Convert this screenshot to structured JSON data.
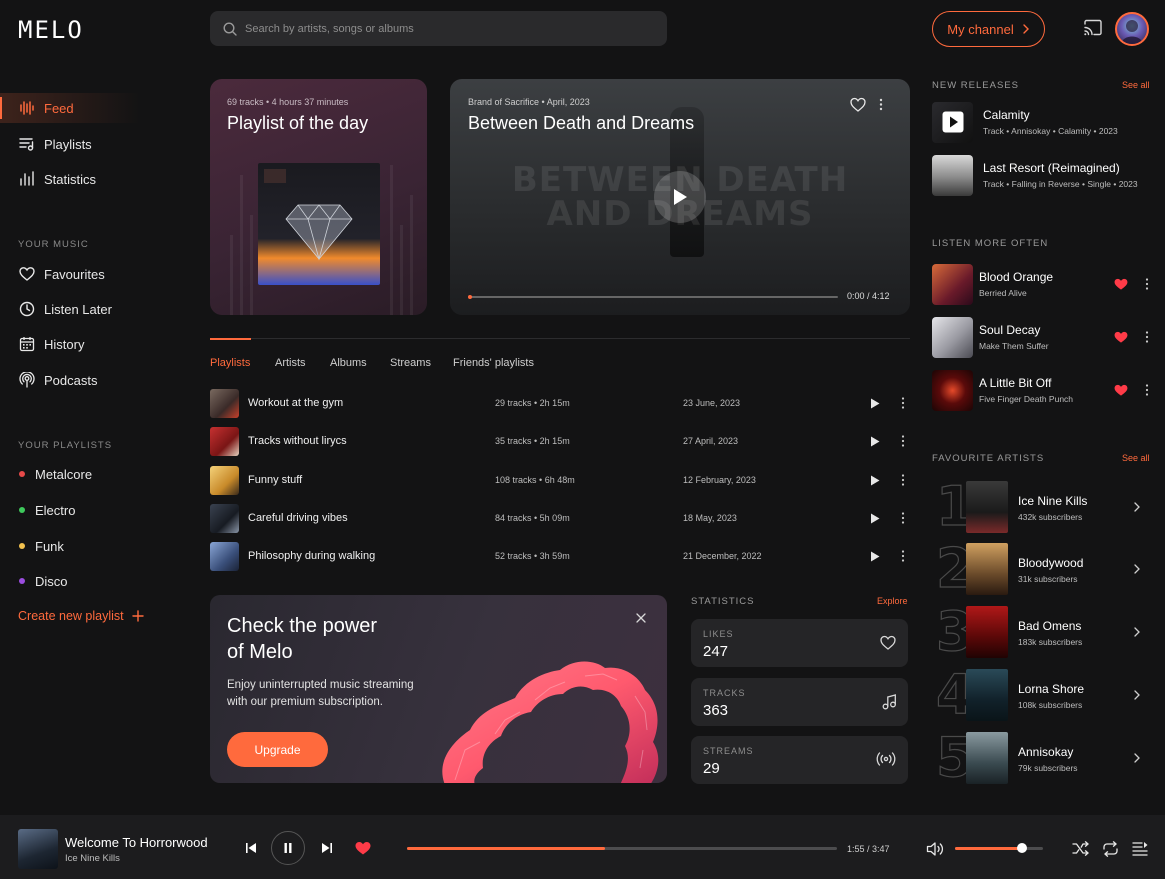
{
  "app": {
    "logo": "MELO"
  },
  "search": {
    "placeholder": "Search by artists, songs or albums"
  },
  "header": {
    "my_channel": "My channel"
  },
  "nav": [
    {
      "label": "Feed",
      "icon": "bars-icon"
    },
    {
      "label": "Playlists",
      "icon": "playlist-icon"
    },
    {
      "label": "Statistics",
      "icon": "statistics-icon"
    }
  ],
  "your_music": {
    "title": "YOUR MUSIC",
    "items": [
      {
        "label": "Favourites",
        "icon": "heart-icon"
      },
      {
        "label": "Listen Later",
        "icon": "clock-icon"
      },
      {
        "label": "History",
        "icon": "calendar-icon"
      },
      {
        "label": "Podcasts",
        "icon": "podcast-icon"
      }
    ]
  },
  "your_playlists": {
    "title": "YOUR PLAYLISTS",
    "items": [
      {
        "label": "Metalcore",
        "color": "#e84a4a"
      },
      {
        "label": "Electro",
        "color": "#3ec95c"
      },
      {
        "label": "Funk",
        "color": "#f2c14e"
      },
      {
        "label": "Disco",
        "color": "#9b4de0"
      }
    ],
    "create": "Create new playlist"
  },
  "playlist_of_day": {
    "tracks": "69 tracks",
    "duration": "4 hours 37 minutes",
    "title": "Playlist of the day"
  },
  "featured_video": {
    "artist": "Brand of Sacrifice",
    "date": "April, 2023",
    "title": "Between Death and Dreams",
    "overlay_text": "BETWEEN DEATH AND DREAMS",
    "time": "0:00 / 4:12"
  },
  "tabs": [
    "Playlists",
    "Artists",
    "Albums",
    "Streams",
    "Friends' playlists"
  ],
  "playlists": [
    {
      "name": "Workout at the gym",
      "tracks": "29 tracks",
      "duration": "2h 15m",
      "date": "23 June, 2023",
      "thumb": "linear-gradient(135deg,#7a6a60,#3a2a28 60%,#c9402a)"
    },
    {
      "name": "Tracks without lirycs",
      "tracks": "35 tracks",
      "duration": "2h 15m",
      "date": "27 April, 2023",
      "thumb": "linear-gradient(135deg,#c73131,#7a1515 60%,#e6d3c0)"
    },
    {
      "name": "Funny stuff",
      "tracks": "108 tracks",
      "duration": "6h 48m",
      "date": "12 February, 2023",
      "thumb": "linear-gradient(135deg,#f4d27a,#c88a2a 60%,#3a2a1a)"
    },
    {
      "name": "Careful driving vibes",
      "tracks": "84 tracks",
      "duration": "5h 09m",
      "date": "18 May, 2023",
      "thumb": "linear-gradient(135deg,#3a4250,#171b22 60%,#8a96a8)"
    },
    {
      "name": "Philosophy during walking",
      "tracks": "52 tracks",
      "duration": "3h 59m",
      "date": "21 December, 2022",
      "thumb": "linear-gradient(135deg,#8aa6d6,#3a4f7a 60%,#1a2236)"
    }
  ],
  "promo": {
    "title_line1": "Check the power",
    "title_line2": "of Melo",
    "body": "Enjoy uninterrupted music streaming with our premium subscription.",
    "button": "Upgrade"
  },
  "statistics": {
    "title": "STATISTICS",
    "explore": "Explore",
    "cards": [
      {
        "label": "LIKES",
        "value": "247",
        "icon": "heart-outline-icon"
      },
      {
        "label": "TRACKS",
        "value": "363",
        "icon": "music-note-icon"
      },
      {
        "label": "STREAMS",
        "value": "29",
        "icon": "broadcast-icon"
      }
    ]
  },
  "new_releases": {
    "title": "NEW RELEASES",
    "see_all": "See all",
    "items": [
      {
        "title": "Calamity",
        "meta": "Track • Annisokay • Calamity • 2023",
        "art": "linear-gradient(135deg,#2a2a2e,#111)"
      },
      {
        "title": "Last Resort (Reimagined)",
        "meta": "Track • Falling in Reverse • Single • 2023",
        "art": "linear-gradient(180deg,#d9d9d9,#8a8a8a 55%,#3a3a3a)"
      }
    ]
  },
  "listen_more": {
    "title": "LISTEN MORE OFTEN",
    "items": [
      {
        "title": "Blood Orange",
        "artist": "Berried Alive",
        "art": "linear-gradient(135deg,#d86b3a,#6a1a2a 60%,#2a0a1a)"
      },
      {
        "title": "Soul Decay",
        "artist": "Make Them Suffer",
        "art": "linear-gradient(135deg,#e6e6ea,#9a9aa2 55%,#4a4a52)"
      },
      {
        "title": "A Little Bit Off",
        "artist": "Five Finger Death Punch",
        "art": "radial-gradient(circle,#e64a2a 0%,#5a0a0a 45%,#1a0505 100%)"
      }
    ]
  },
  "favourite_artists": {
    "title": "FAVOURITE ARTISTS",
    "see_all": "See all",
    "items": [
      {
        "rank": "1",
        "name": "Ice Nine Kills",
        "subs": "432k subscribers",
        "art": "linear-gradient(180deg,#3a3a3a,#1a1a1a 60%,#7a2a2a)"
      },
      {
        "rank": "2",
        "name": "Bloodywood",
        "subs": "31k subscribers",
        "art": "linear-gradient(180deg,#d0a060,#6a4a2a 60%,#2a1a10)"
      },
      {
        "rank": "3",
        "name": "Bad Omens",
        "subs": "183k subscribers",
        "art": "linear-gradient(180deg,#b01818,#5a0808 60%,#200303)"
      },
      {
        "rank": "4",
        "name": "Lorna Shore",
        "subs": "108k subscribers",
        "art": "linear-gradient(180deg,#2a4a58,#11212a 60%,#0a1418)"
      },
      {
        "rank": "5",
        "name": "Annisokay",
        "subs": "79k subscribers",
        "art": "linear-gradient(180deg,#8a9aa0,#3a4a50 60%,#1a2226)"
      }
    ]
  },
  "now_playing": {
    "title": "Welcome To Horrorwood",
    "artist": "Ice Nine Kills",
    "time": "1:55 / 3:47",
    "progress_fraction": 0.46,
    "volume_fraction": 0.76
  }
}
